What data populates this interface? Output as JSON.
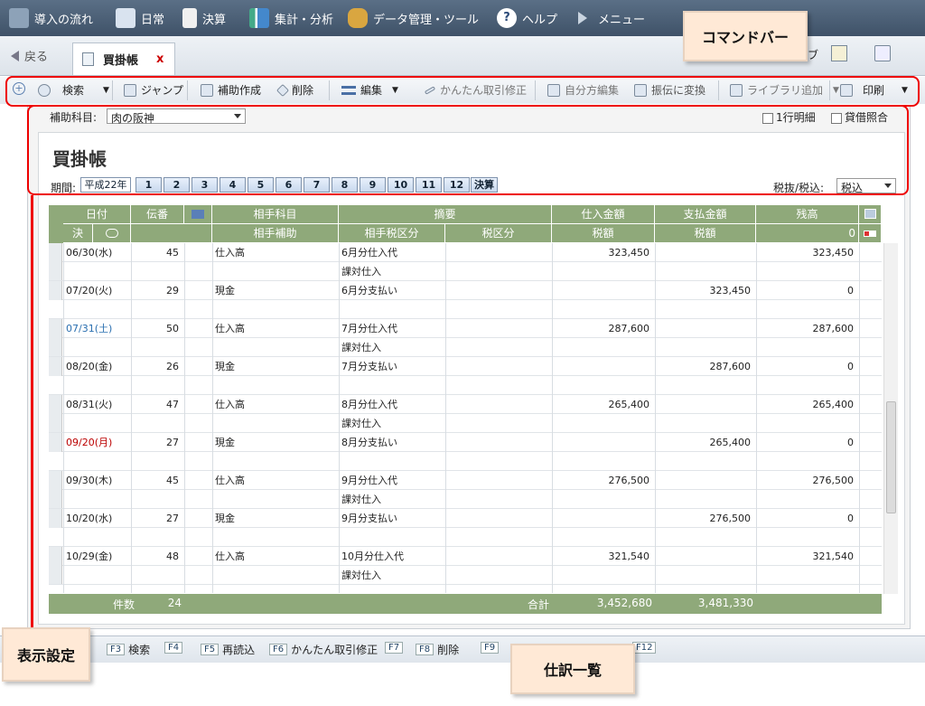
{
  "menubar": {
    "items": [
      {
        "label": "導入の流れ",
        "icon": "flow-icon"
      },
      {
        "label": "日常",
        "icon": "pen-icon"
      },
      {
        "label": "決算",
        "icon": "document-icon"
      },
      {
        "label": "集計・分析",
        "icon": "chart-icon"
      },
      {
        "label": "データ管理・ツール",
        "icon": "database-icon"
      },
      {
        "label": "ヘルプ",
        "icon": "help-icon"
      },
      {
        "label": "メニュー",
        "icon": "play-icon"
      }
    ]
  },
  "tabs": {
    "back_label": "戻る",
    "active_tab": "買掛帳",
    "close_symbol": "x",
    "partial_label": "ブ"
  },
  "toolbar": {
    "search": "検索",
    "jump": "ジャンプ",
    "create_sub": "補助作成",
    "delete": "削除",
    "edit": "編集",
    "simple_fix": "かんたん取引修正",
    "self_edit": "自分方編集",
    "convert": "振伝に変換",
    "library_add": "ライブラリ追加",
    "print": "印刷"
  },
  "filter": {
    "subaccount_label": "補助科目:",
    "subaccount_value": "肉の阪神",
    "one_line_detail": "1行明細",
    "debit_credit_check": "貸借照合"
  },
  "ledger": {
    "title": "買掛帳",
    "period_label": "期間:",
    "era": "平成22年",
    "months": [
      "1",
      "2",
      "3",
      "4",
      "5",
      "6",
      "7",
      "8",
      "9",
      "10",
      "11",
      "12"
    ],
    "closing": "決算",
    "tax_label": "税抜/税込:",
    "tax_value": "税込"
  },
  "grid": {
    "header_top": [
      "日付",
      "伝番",
      "",
      "相手科目",
      "摘要",
      "仕入金額",
      "支払金額",
      "残高",
      ""
    ],
    "header_bottom": [
      "決",
      "",
      "",
      "相手補助",
      "相手税区分",
      "税区分",
      "税額",
      "税額",
      "0"
    ],
    "rows": [
      {
        "date": "06/30(水)",
        "no": "45",
        "account": "仕入高",
        "memo": "6月分仕入代",
        "sub_memo": "課対仕入",
        "purchase": "323,450",
        "payment": "",
        "balance": "323,450",
        "color": "#222"
      },
      {
        "date": "07/20(火)",
        "no": "29",
        "account": "現金",
        "memo": "6月分支払い",
        "sub_memo": "",
        "purchase": "",
        "payment": "323,450",
        "balance": "0",
        "color": "#222"
      },
      {
        "date": "07/31(土)",
        "no": "50",
        "account": "仕入高",
        "memo": "7月分仕入代",
        "sub_memo": "課対仕入",
        "purchase": "287,600",
        "payment": "",
        "balance": "287,600",
        "color": "#2a6fb0"
      },
      {
        "date": "08/20(金)",
        "no": "26",
        "account": "現金",
        "memo": "7月分支払い",
        "sub_memo": "",
        "purchase": "",
        "payment": "287,600",
        "balance": "0",
        "color": "#222"
      },
      {
        "date": "08/31(火)",
        "no": "47",
        "account": "仕入高",
        "memo": "8月分仕入代",
        "sub_memo": "課対仕入",
        "purchase": "265,400",
        "payment": "",
        "balance": "265,400",
        "color": "#222"
      },
      {
        "date": "09/20(月)",
        "no": "27",
        "account": "現金",
        "memo": "8月分支払い",
        "sub_memo": "",
        "purchase": "",
        "payment": "265,400",
        "balance": "0",
        "color": "#b00"
      },
      {
        "date": "09/30(木)",
        "no": "45",
        "account": "仕入高",
        "memo": "9月分仕入代",
        "sub_memo": "課対仕入",
        "purchase": "276,500",
        "payment": "",
        "balance": "276,500",
        "color": "#222"
      },
      {
        "date": "10/20(水)",
        "no": "27",
        "account": "現金",
        "memo": "9月分支払い",
        "sub_memo": "",
        "purchase": "",
        "payment": "276,500",
        "balance": "0",
        "color": "#222"
      },
      {
        "date": "10/29(金)",
        "no": "48",
        "account": "仕入高",
        "memo": "10月分仕入代",
        "sub_memo": "課対仕入",
        "purchase": "321,540",
        "payment": "",
        "balance": "321,540",
        "color": "#222"
      }
    ],
    "footer": {
      "count_label": "件数",
      "count": "24",
      "total_label": "合計",
      "purchase_total": "3,452,680",
      "payment_total": "3,481,330"
    }
  },
  "fkeys": [
    {
      "key": "F3",
      "label": "検索"
    },
    {
      "key": "F4",
      "label": ""
    },
    {
      "key": "F5",
      "label": "再読込"
    },
    {
      "key": "F6",
      "label": "かんたん取引修正"
    },
    {
      "key": "F7",
      "label": ""
    },
    {
      "key": "F8",
      "label": "削除"
    },
    {
      "key": "F9",
      "label": ""
    },
    {
      "key": "F12",
      "label": ""
    }
  ],
  "callouts": {
    "command_bar": "コマンドバー",
    "display_settings": "表示設定",
    "journal_list": "仕訳一覧"
  }
}
